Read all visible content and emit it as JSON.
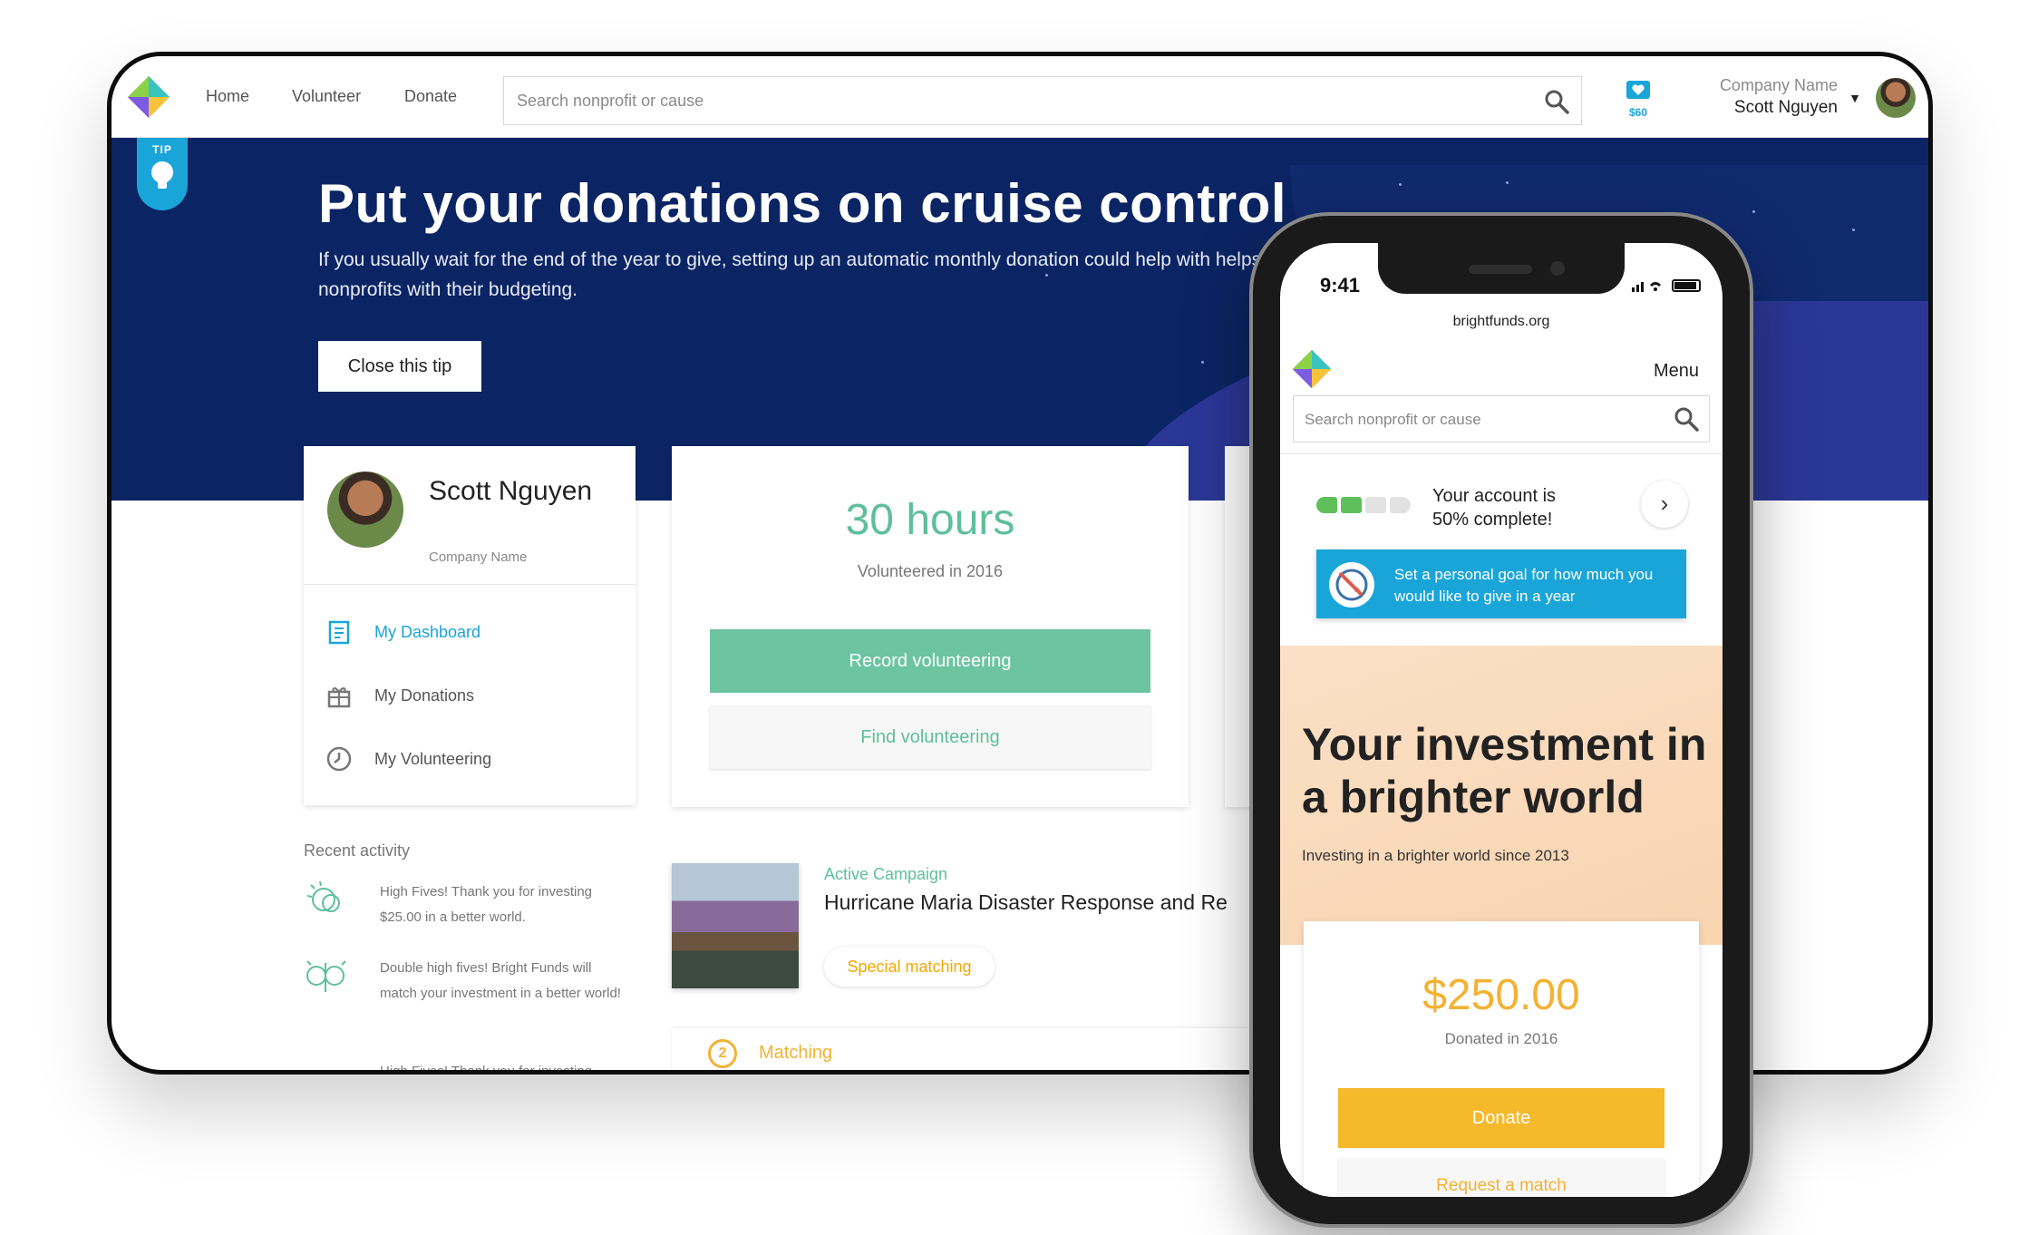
{
  "desktop": {
    "nav": {
      "home": "Home",
      "volunteer": "Volunteer",
      "donate": "Donate"
    },
    "search": {
      "placeholder": "Search nonprofit or cause"
    },
    "wallet": {
      "amount": "$60"
    },
    "account": {
      "company": "Company Name",
      "name": "Scott Nguyen"
    },
    "tip": {
      "tab_label": "TIP",
      "title": "Put your donations on cruise control",
      "description": "If you usually wait for the end of the year to give, setting up an automatic monthly donation could help with helps nonprofits with their budgeting.",
      "close_label": "Close this tip"
    },
    "profile": {
      "name": "Scott Nguyen",
      "company": "Company Name",
      "menu": [
        {
          "label": "My Dashboard",
          "icon": "dashboard-icon"
        },
        {
          "label": "My Donations",
          "icon": "gift-icon"
        },
        {
          "label": "My Volunteering",
          "icon": "clock-icon"
        }
      ]
    },
    "volunteering": {
      "hours": "30 hours",
      "subtitle": "Volunteered in 2016",
      "record_label": "Record volunteering",
      "find_label": "Find volunteering"
    },
    "recent_activity": {
      "title": "Recent activity",
      "items": [
        {
          "text": "High Fives! Thank you for investing $25.00 in a better world."
        },
        {
          "text": "Double high fives! Bright Funds will match your investment in a better world!"
        },
        {
          "text": "High Fives! Thank you for investing"
        }
      ]
    },
    "campaign": {
      "label": "Active Campaign",
      "title": "Hurricane Maria Disaster Response and Re",
      "special_label": "Special matching",
      "matching_label": "Matching",
      "matching_number": "2"
    }
  },
  "mobile": {
    "time": "9:41",
    "url": "brightfunds.org",
    "menu_label": "Menu",
    "search": {
      "placeholder": "Search nonprofit or cause"
    },
    "account_status": {
      "line1": "Your account is",
      "line2": "50% complete!",
      "progress": 0.5
    },
    "goal_prompt": "Set a personal goal for how much you would like to give in a year",
    "hero": {
      "title": "Your investment in a brighter world",
      "subtitle": "Investing in a brighter world since 2013"
    },
    "donation": {
      "amount": "$250.00",
      "subtitle": "Donated in 2016",
      "donate_label": "Donate",
      "request_label": "Request a match"
    }
  },
  "colors": {
    "accent_blue": "#1aa5d8",
    "hero_navy": "#0b2463",
    "green": "#6cc4a1",
    "gold": "#f2b233"
  }
}
